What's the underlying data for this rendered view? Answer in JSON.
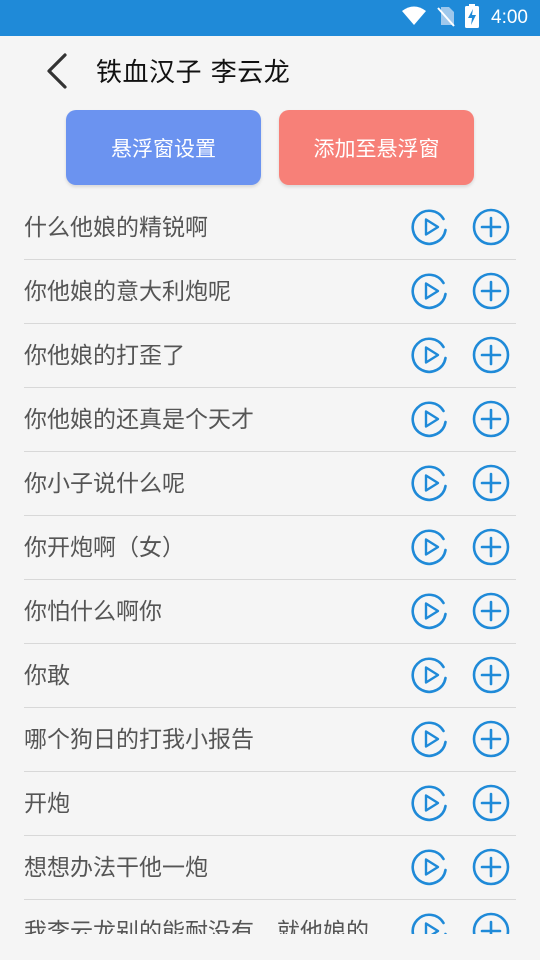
{
  "status_bar": {
    "time": "4:00",
    "background": "#1f8ad8"
  },
  "header": {
    "title": "铁血汉子 李云龙"
  },
  "actions": {
    "settings_label": "悬浮窗设置",
    "add_label": "添加至悬浮窗",
    "settings_color": "#6b93f0",
    "add_color": "#f78078"
  },
  "icon_color": "#1f8ad8",
  "clips": [
    "什么他娘的精锐啊",
    "你他娘的意大利炮呢",
    "你他娘的打歪了",
    "你他娘的还真是个天才",
    "你小子说什么呢",
    "你开炮啊（女）",
    "你怕什么啊你",
    "你敢",
    "哪个狗日的打我小报告",
    "开炮",
    "想想办法干他一炮",
    "我李云龙别的能耐没有，就他娘的"
  ]
}
